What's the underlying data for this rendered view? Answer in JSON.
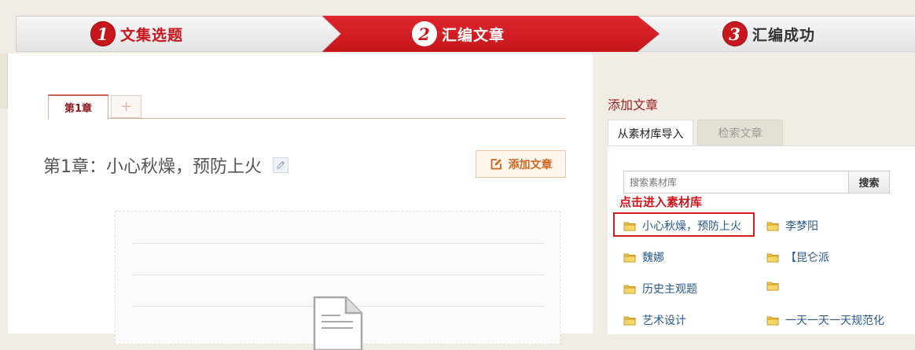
{
  "steps": [
    {
      "number": "1",
      "label": "文集选题"
    },
    {
      "number": "2",
      "label": "汇编文章"
    },
    {
      "number": "3",
      "label": "汇编成功"
    }
  ],
  "editor": {
    "chapter_tab": "第1章",
    "add_tab_symbol": "+",
    "chapter_title": "第1章：小心秋燥，预防上火",
    "add_article_button": "添加文章"
  },
  "sidebar": {
    "title": "添加文章",
    "tabs": [
      "从素材库导入",
      "检索文章"
    ],
    "search_placeholder": "搜索素材库",
    "search_button": "搜索",
    "hint": "点击进入素材库",
    "folders_left": [
      "小心秋燥，预防上火",
      "魏娜",
      "历史主观题",
      "艺术设计"
    ],
    "folders_right": [
      "李梦阳",
      "【昆仑派",
      "",
      "一天一天一天规范化"
    ]
  },
  "colors": {
    "accent_red": "#c8161d",
    "link_blue": "#2a5a8a",
    "button_orange": "#d2641d"
  }
}
